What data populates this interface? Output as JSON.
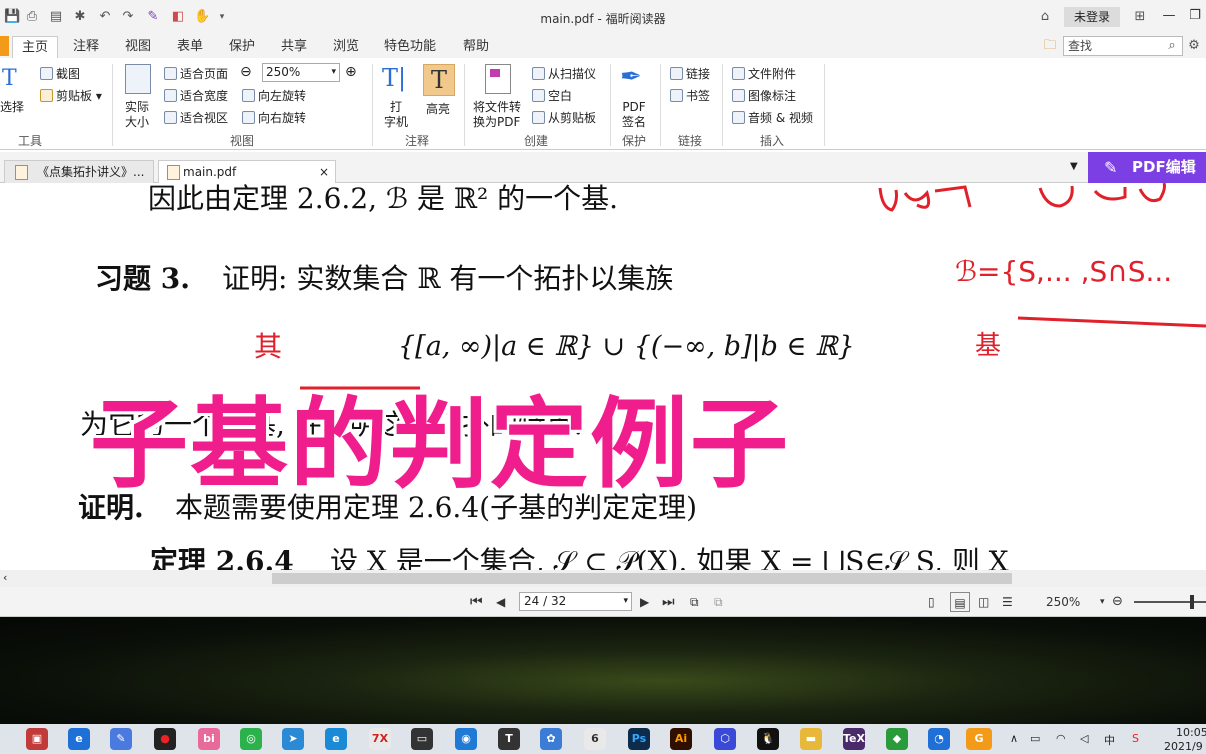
{
  "window": {
    "title": "main.pdf - 福昕阅读器",
    "login": "未登录",
    "search_placeholder": "查找"
  },
  "menu": [
    "主页",
    "注释",
    "视图",
    "表单",
    "保护",
    "共享",
    "浏览",
    "特色功能",
    "帮助"
  ],
  "ribbon": {
    "select": "选择",
    "screenshot": "截图",
    "clipboard": "剪贴板",
    "group_tools": "工具",
    "actual_size": [
      "实际",
      "大小"
    ],
    "fit_page": "适合页面",
    "fit_width": "适合宽度",
    "fit_view": "适合视区",
    "zoom": "250%",
    "rotate_left": "向左旋转",
    "rotate_right": "向右旋转",
    "group_view": "视图",
    "typewriter": [
      "打",
      "字机"
    ],
    "highlight": "高亮",
    "group_comment": "注释",
    "convert": [
      "将文件转",
      "换为PDF"
    ],
    "from_scanner": "从扫描仪",
    "blank": "空白",
    "from_clipboard": "从剪贴板",
    "group_create": "创建",
    "pdf_sign": [
      "PDF",
      "签名"
    ],
    "group_protect": "保护",
    "link": "链接",
    "bookmark": "书签",
    "group_link": "链接",
    "attachment": "文件附件",
    "image_note": "图像标注",
    "audio_video": "音频 & 视频",
    "group_insert": "插入"
  },
  "tabs": [
    "《点集拓扑讲义》...",
    "main.pdf"
  ],
  "pdf_edit": "PDF编辑",
  "document": {
    "line1": "因此由定理 2.6.2, ℬ 是 ℝ² 的一个基.",
    "exercise_label": "习题 3.",
    "exercise_text": "证明: 实数集合 ℝ 有一个拓扑以集族",
    "formula": "{[a, ∞)|a ∈ ℝ} ∪ {(−∞, b]|b ∈ ℝ}",
    "line_hidden": "为它的一个子基, 并说明这个拓扑的特点.",
    "proof_label": "证明.",
    "proof_text": "本题需要使用定理 2.6.4(子基的判定定理)",
    "theorem_label": "定理 2.6.4",
    "theorem_text": "设 X 是一个集合, 𝒮 ⊂ 𝒫(X). 如果 X = ⋃S∈𝒮 S, 则 X",
    "handwriting": "其",
    "handwriting2": "ℬ={S,... ,S∩S...",
    "handwriting3": "基"
  },
  "banner": "子基的判定例子",
  "status": {
    "page": "24 / 32",
    "zoom": "250%"
  },
  "clock": "10:05",
  "date": "2021/9",
  "ime": "中",
  "colors": {
    "accent": "#f39a19",
    "pdf_edit": "#7b3fe4",
    "banner": "#f01e8c",
    "ink": "#e0202a"
  }
}
